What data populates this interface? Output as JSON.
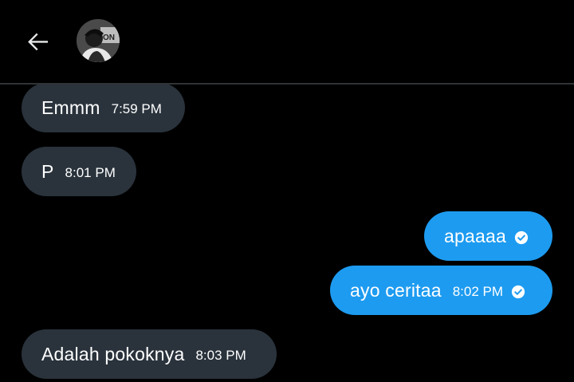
{
  "header": {
    "back_icon": "arrow-left-icon",
    "avatar_icon": "user-avatar"
  },
  "colors": {
    "background": "#000000",
    "incoming_bubble": "#2a333c",
    "outgoing_bubble": "#1d9bf0",
    "divider": "#2f3336",
    "text": "#ffffff"
  },
  "messages": [
    {
      "direction": "incoming",
      "text": "Emmm",
      "time": "7:59 PM"
    },
    {
      "direction": "incoming",
      "text": "P",
      "time": "8:01 PM"
    },
    {
      "direction": "outgoing",
      "text": "apaaaa",
      "time": "",
      "status_icon": "check-circle-icon"
    },
    {
      "direction": "outgoing",
      "text": "ayo ceritaa",
      "time": "8:02 PM",
      "status_icon": "check-circle-icon"
    },
    {
      "direction": "incoming",
      "text": "Adalah pokoknya",
      "time": "8:03 PM"
    }
  ]
}
